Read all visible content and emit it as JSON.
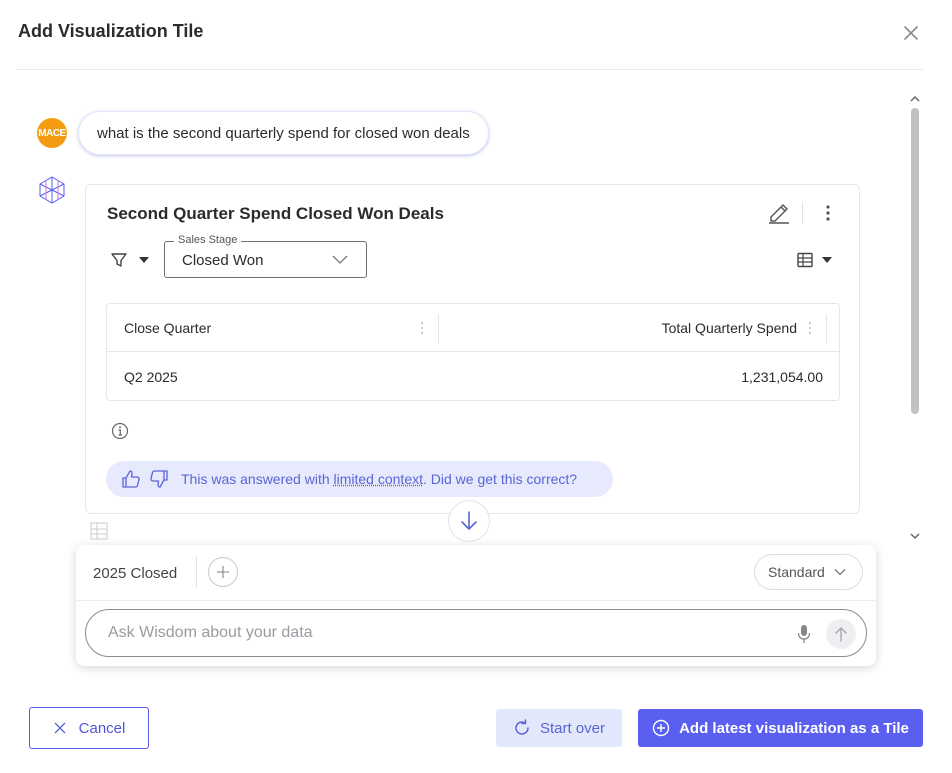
{
  "dialog": {
    "title": "Add Visualization Tile"
  },
  "conversation": {
    "user_avatar_text": "MACE",
    "user_question": "what is the second quarterly spend for closed won deals"
  },
  "result_card": {
    "title": "Second Quarter Spend Closed Won Deals",
    "filter": {
      "label": "Sales Stage",
      "value": "Closed Won"
    },
    "table": {
      "columns": [
        "Close Quarter",
        "Total Quarterly Spend"
      ],
      "rows": [
        [
          "Q2 2025",
          "1,231,054.00"
        ]
      ]
    },
    "feedback": {
      "prefix": "This was answered with ",
      "link": "limited context",
      "suffix": ". Did we get this correct?"
    }
  },
  "input_panel": {
    "context_chip": "2025 Closed",
    "mode": "Standard",
    "placeholder": "Ask Wisdom about your data"
  },
  "footer": {
    "cancel_label": "Cancel",
    "start_over_label": "Start over",
    "add_tile_label": "Add latest visualization as a Tile"
  },
  "colors": {
    "accent": "#5a5ff0",
    "accent_light": "#e3e7fc",
    "avatar": "#f39c12"
  },
  "icons": [
    "close-icon",
    "edit-icon",
    "kebab-icon",
    "filter-icon",
    "chevron-down-icon",
    "table-icon",
    "column-menu-icon",
    "info-icon",
    "thumbs-up-icon",
    "thumbs-down-icon",
    "arrow-down-icon",
    "plus-icon",
    "microphone-icon",
    "send-arrow-icon",
    "refresh-icon",
    "plus-circle-icon"
  ]
}
